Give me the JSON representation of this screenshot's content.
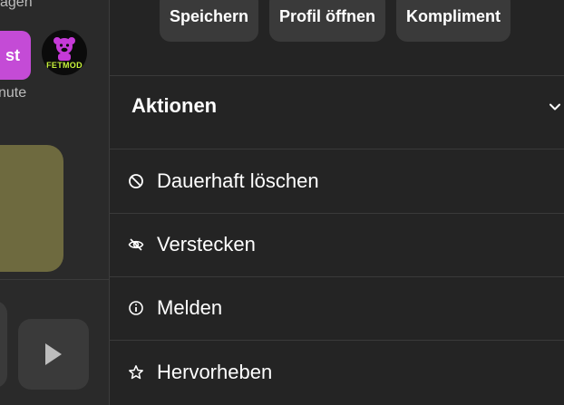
{
  "background": {
    "top_text": "agen",
    "pill_text": "st",
    "avatar_brand": "FETMOD",
    "minute_text": "nute"
  },
  "buttons": {
    "save": "Speichern",
    "open_profile": "Profil öffnen",
    "compliment": "Kompliment"
  },
  "actions": {
    "title": "Aktionen",
    "items": [
      {
        "label": "Dauerhaft löschen",
        "icon": "block-icon"
      },
      {
        "label": "Verstecken",
        "icon": "eye-off-icon"
      },
      {
        "label": "Melden",
        "icon": "info-icon"
      },
      {
        "label": "Hervorheben",
        "icon": "star-icon"
      }
    ]
  },
  "colors": {
    "panel_bg": "#242424",
    "button_bg": "#3a3a3a",
    "accent_pill": "#c44bd6",
    "olive_card": "#6e6a3f"
  }
}
